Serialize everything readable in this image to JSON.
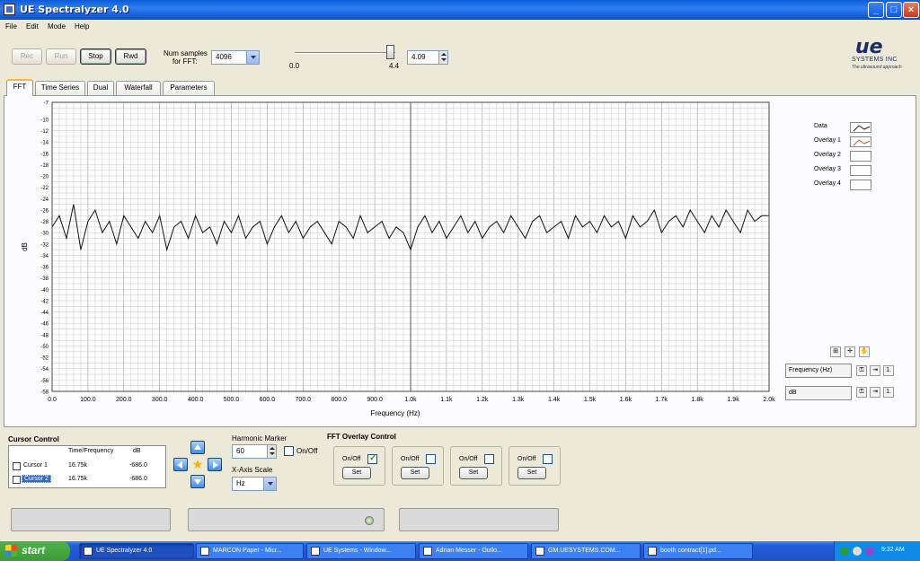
{
  "window": {
    "title": "UE Spectralyzer 4.0"
  },
  "menu": [
    "File",
    "Edit",
    "Mode",
    "Help"
  ],
  "toolbar": {
    "rec": "Rec",
    "run": "Run",
    "stop": "Stop",
    "rwd": "Rwd",
    "num_samples_label_1": "Num samples",
    "num_samples_label_2": "for FFT:",
    "num_samples_value": "4096",
    "slider_min_label": "0.0",
    "slider_value_label": "4.4",
    "slider_numeric": "4.09",
    "slider_fraction": 0.95
  },
  "logo": {
    "brand": "ue",
    "company": "SYSTEMS INC",
    "tagline": "The ultrasound approach"
  },
  "tabs": [
    {
      "label": "FFT",
      "active": true
    },
    {
      "label": "Time Series"
    },
    {
      "label": "Dual"
    },
    {
      "label": "Waterfall"
    },
    {
      "label": "Parameters"
    }
  ],
  "legend": [
    "Data",
    "Overlay 1",
    "Overlay 2",
    "Overlay 3",
    "Overlay 4"
  ],
  "scale": {
    "x_unit": "Frequency (Hz)",
    "y_unit": "dB"
  },
  "chart_data": {
    "type": "line",
    "xlabel": "Frequency (Hz)",
    "ylabel": "dB",
    "xlim": [
      0,
      2000
    ],
    "ylim": [
      -58,
      -7
    ],
    "x_ticks": [
      "0.0",
      "100.0",
      "200.0",
      "300.0",
      "400.0",
      "500.0",
      "600.0",
      "700.0",
      "800.0",
      "900.0",
      "1.0k",
      "1.1k",
      "1.2k",
      "1.3k",
      "1.4k",
      "1.5k",
      "1.6k",
      "1.7k",
      "1.8k",
      "1.9k",
      "2.0k"
    ],
    "y_ticks": [
      "-7",
      "-10",
      "-12",
      "-14",
      "-16",
      "-18",
      "-20",
      "-22",
      "-24",
      "-26",
      "-28",
      "-30",
      "-32",
      "-34",
      "-36",
      "-38",
      "-40",
      "-42",
      "-44",
      "-46",
      "-48",
      "-50",
      "-52",
      "-54",
      "-56",
      "-58"
    ],
    "grid": true,
    "series": [
      {
        "name": "Data",
        "color": "#111111",
        "x": [
          0,
          20,
          40,
          60,
          80,
          100,
          120,
          140,
          160,
          180,
          200,
          220,
          240,
          260,
          280,
          300,
          320,
          340,
          360,
          380,
          400,
          420,
          440,
          460,
          480,
          500,
          520,
          540,
          560,
          580,
          600,
          620,
          640,
          660,
          680,
          700,
          720,
          740,
          760,
          780,
          800,
          820,
          840,
          860,
          880,
          900,
          920,
          940,
          960,
          980,
          1000,
          1020,
          1040,
          1060,
          1080,
          1100,
          1120,
          1140,
          1160,
          1180,
          1200,
          1220,
          1240,
          1260,
          1280,
          1300,
          1320,
          1340,
          1360,
          1380,
          1400,
          1420,
          1440,
          1460,
          1480,
          1500,
          1520,
          1540,
          1560,
          1580,
          1600,
          1620,
          1640,
          1660,
          1680,
          1700,
          1720,
          1740,
          1760,
          1780,
          1800,
          1820,
          1840,
          1860,
          1880,
          1900,
          1920,
          1940,
          1960,
          1980,
          2000
        ],
        "y": [
          -29,
          -27,
          -31,
          -25,
          -33,
          -28,
          -26,
          -30,
          -28,
          -32,
          -27,
          -29,
          -31,
          -28,
          -30,
          -27,
          -33,
          -29,
          -28,
          -31,
          -27,
          -30,
          -29,
          -32,
          -28,
          -30,
          -27,
          -31,
          -29,
          -28,
          -32,
          -29,
          -27,
          -30,
          -28,
          -31,
          -29,
          -28,
          -30,
          -32,
          -28,
          -29,
          -31,
          -27,
          -30,
          -29,
          -28,
          -31,
          -29,
          -30,
          -33,
          -29,
          -27,
          -30,
          -28,
          -31,
          -29,
          -27,
          -30,
          -28,
          -31,
          -29,
          -28,
          -30,
          -27,
          -29,
          -31,
          -28,
          -27,
          -30,
          -29,
          -28,
          -31,
          -27,
          -29,
          -28,
          -30,
          -27,
          -29,
          -28,
          -31,
          -27,
          -29,
          -28,
          -26,
          -30,
          -28,
          -27,
          -29,
          -26,
          -28,
          -30,
          -27,
          -29,
          -26,
          -28,
          -30,
          -26,
          -28,
          -27,
          -27
        ]
      }
    ]
  },
  "cursor_control": {
    "title": "Cursor Control",
    "headers": [
      "Time/Frequency",
      "dB"
    ],
    "rows": [
      {
        "name": "Cursor 1",
        "freq": "16.75k",
        "db": "-686.0",
        "selected": false
      },
      {
        "name": "Cursor 2",
        "freq": "16.75k",
        "db": "-686.0",
        "selected": true
      }
    ]
  },
  "harmonic": {
    "label": "Harmonic Marker",
    "value": "60",
    "onoff": "On/Off"
  },
  "xaxis_scale": {
    "label": "X-Axis Scale",
    "value": "Hz"
  },
  "overlay_control": {
    "title": "FFT Overlay Control",
    "items": [
      {
        "onoff": "On/Off",
        "set": "Set",
        "checked": true
      },
      {
        "onoff": "On/Off",
        "set": "Set",
        "checked": false
      },
      {
        "onoff": "On/Off",
        "set": "Set",
        "checked": false
      },
      {
        "onoff": "On/Off",
        "set": "Set",
        "checked": false
      }
    ]
  },
  "taskbar": {
    "start": "start",
    "tasks": [
      {
        "label": "UE Spectralyzer 4.0",
        "active": true
      },
      {
        "label": "MARCON Paper - Micr..."
      },
      {
        "label": "UE Systems - Window..."
      },
      {
        "label": "Adrian Messer - Outlo..."
      },
      {
        "label": "GM.UESYSTEMS.COM..."
      },
      {
        "label": "booth contract[1].pd..."
      }
    ],
    "clock": "9:32 AM"
  }
}
